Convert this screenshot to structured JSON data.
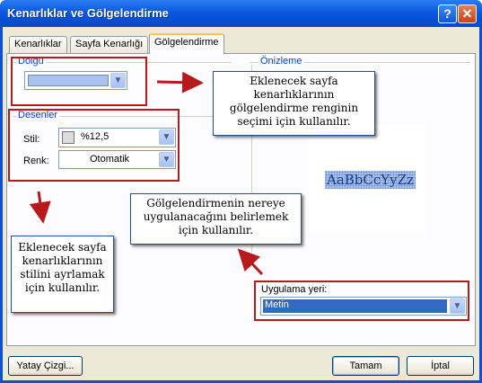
{
  "window": {
    "title": "Kenarlıklar ve Gölgelendirme",
    "help_icon_glyph": "?",
    "close_icon_glyph": "✕"
  },
  "tabs": [
    {
      "label": "Kenarlıklar"
    },
    {
      "label": "Sayfa Kenarlığı"
    },
    {
      "label": "Gölgelendirme"
    }
  ],
  "fill": {
    "group_label": "Dolgu",
    "color_value": "",
    "swatch_color": "#a9c3ee"
  },
  "patterns": {
    "group_label": "Desenler",
    "style_label": "Stil:",
    "style_value": "%12,5",
    "color_label": "Renk:",
    "color_value": "Otomatik"
  },
  "preview": {
    "group_label": "Önizleme",
    "sample_text": "AaBbCcYyZz"
  },
  "apply_to": {
    "label": "Uygulama yeri:",
    "value": "Metin"
  },
  "buttons": {
    "horizontal_line": "Yatay Çizgi...",
    "ok": "Tamam",
    "cancel": "İptal"
  },
  "callouts": {
    "fill_note": "Eklenecek sayfa kenarlıklarının gölgelendirme renginin seçimi için kullanılır.",
    "apply_note": "Gölgelendirmenin nereye uygulanacağını belirlemek için kullanılır.",
    "style_note": "Eklenecek sayfa kenarlıklarının stilini ayrlamak için kullanılır."
  },
  "colors": {
    "titlebar": "#0a50d8",
    "accent_red": "#b7191d",
    "selection_blue": "#316ac5"
  }
}
